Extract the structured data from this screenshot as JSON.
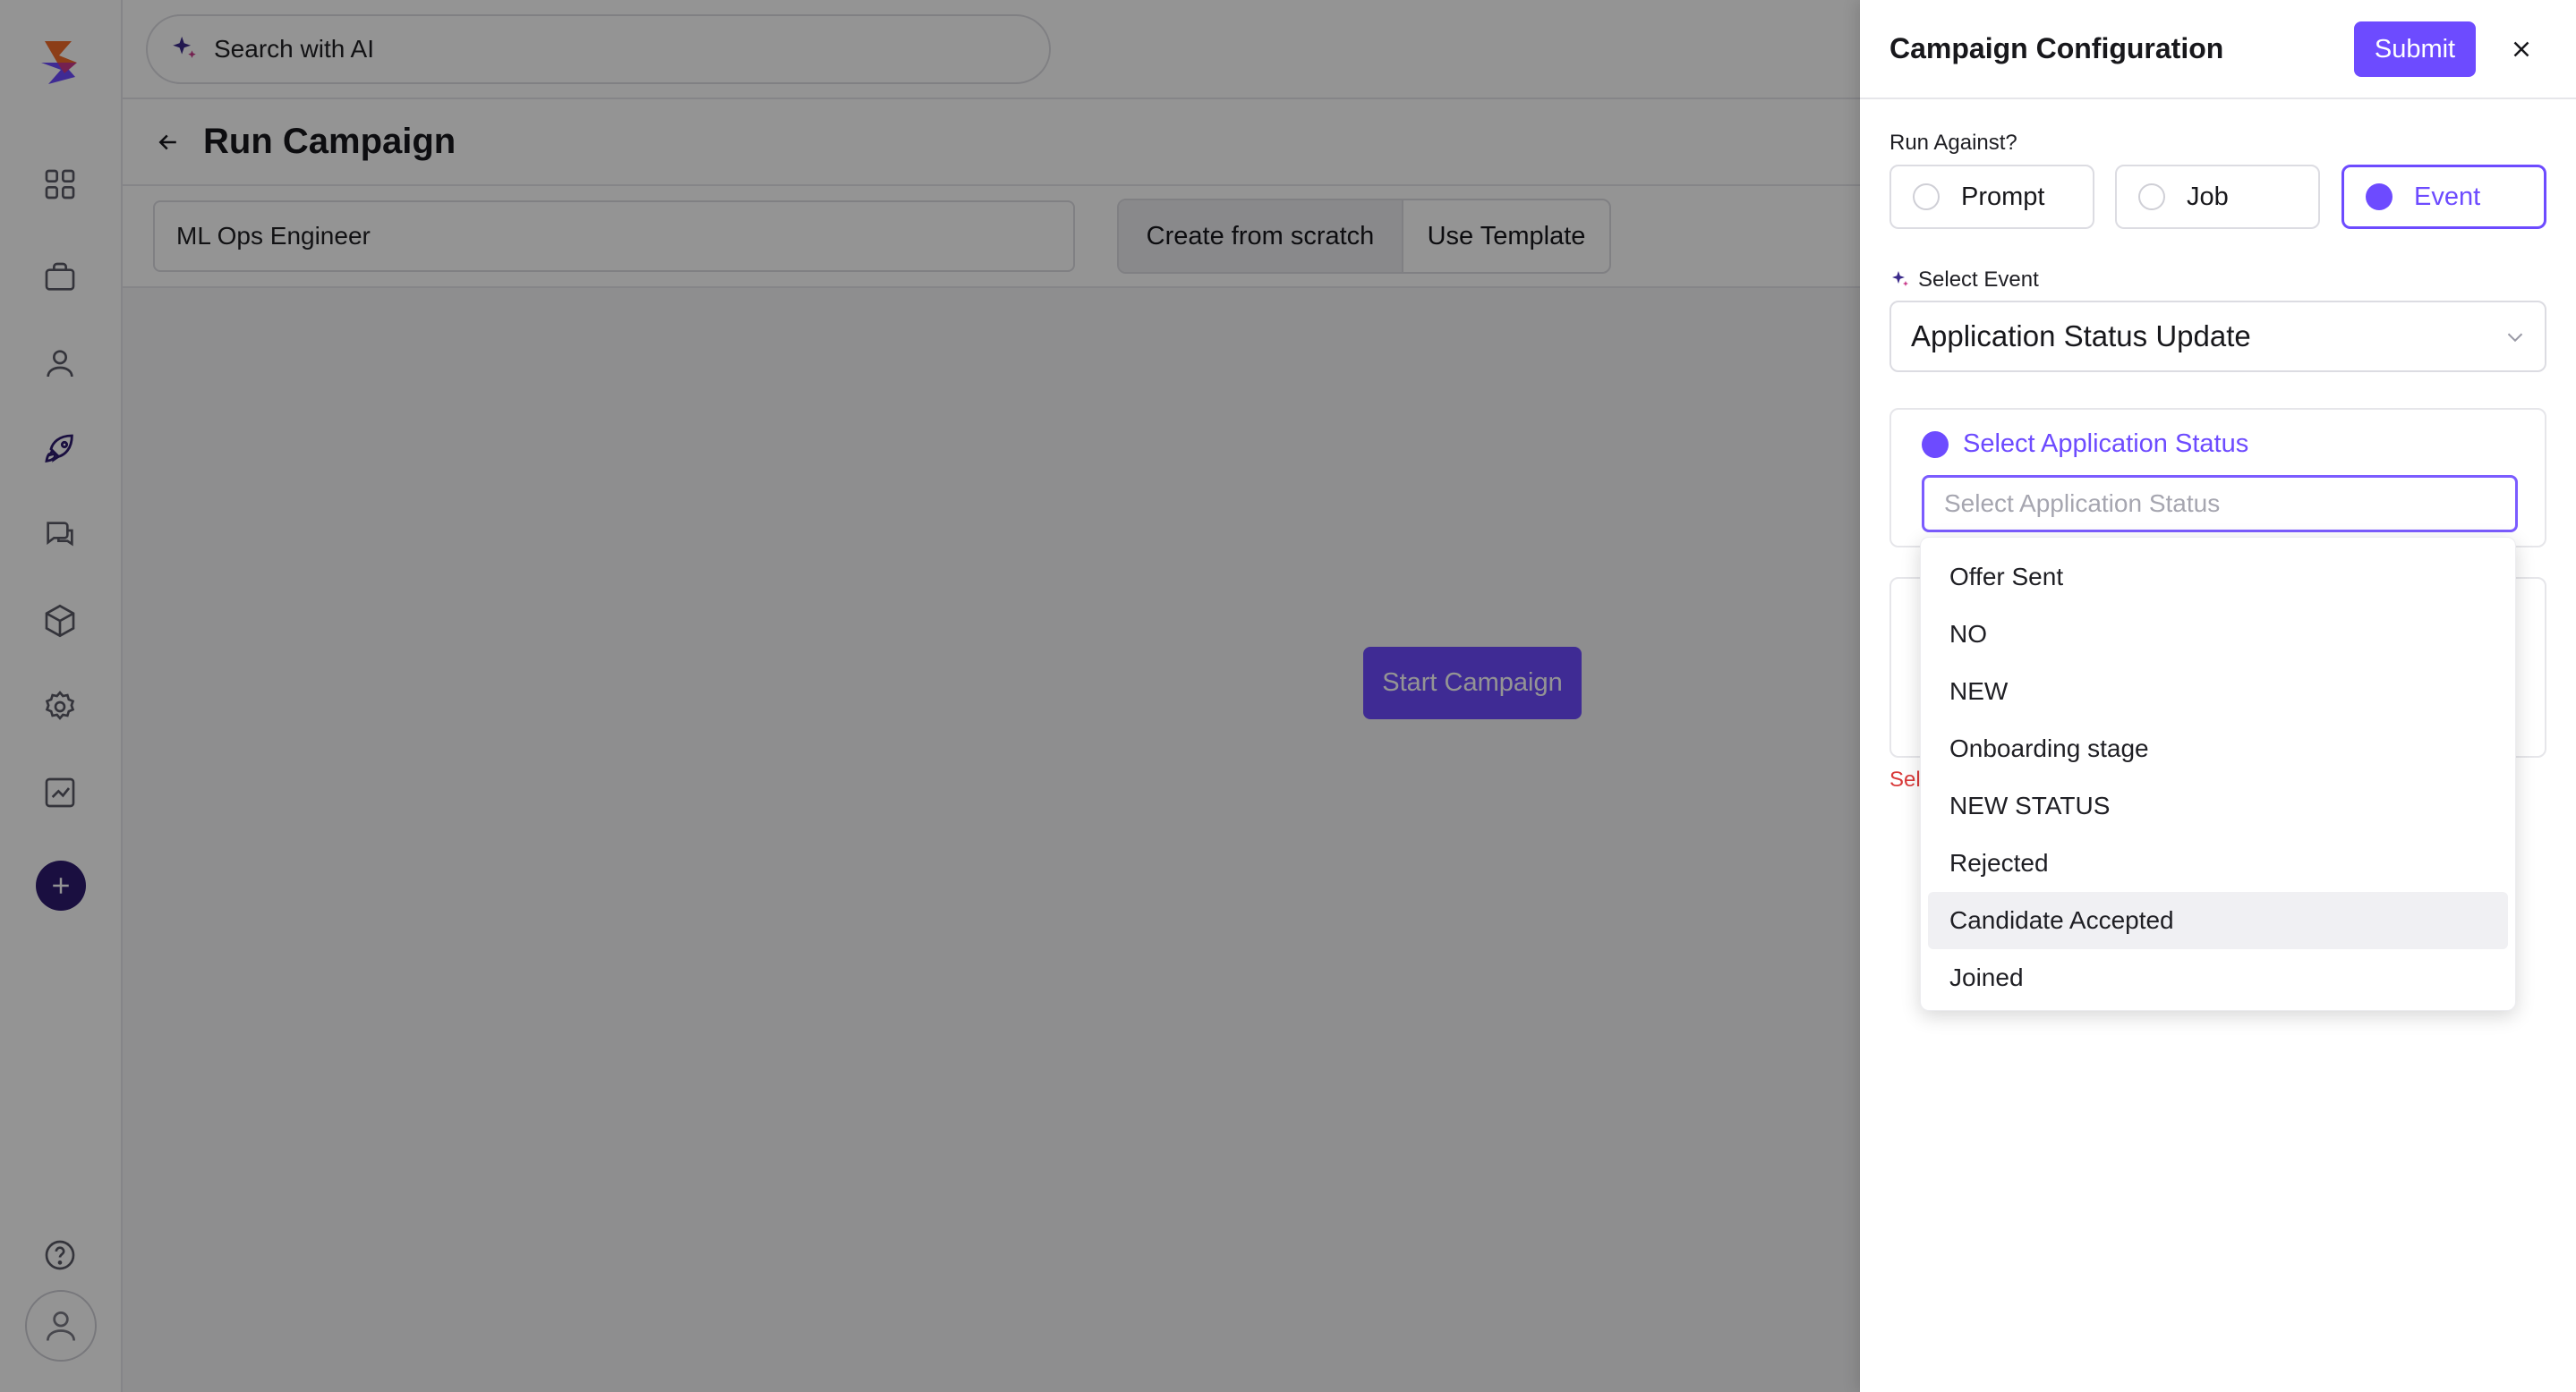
{
  "search": {
    "label": "Search with AI"
  },
  "page": {
    "title": "Run Campaign"
  },
  "campaign": {
    "name_value": "ML Ops Engineer",
    "mode_options": [
      "Create from scratch",
      "Use Template"
    ],
    "start_label": "Start Campaign"
  },
  "drawer": {
    "title": "Campaign Configuration",
    "submit_label": "Submit",
    "run_against_label": "Run Against?",
    "run_against_options": [
      "Prompt",
      "Job",
      "Event"
    ],
    "run_against_selected": "Event",
    "select_event_label": "Select Event",
    "event_value": "Application Status Update",
    "status_section_label": "Select Application Status",
    "status_placeholder": "Select Application Status",
    "status_options": [
      "Offer Sent",
      "NO",
      "NEW",
      "Onboarding stage",
      "NEW STATUS",
      "Rejected",
      "Candidate Accepted",
      "Joined"
    ],
    "hovered_option": "Candidate Accepted",
    "error_prefix": "Sel"
  },
  "colors": {
    "accent": "#6d4bff",
    "logo_orange": "#f26b2a",
    "logo_purple": "#6d4bff",
    "nav_dark": "#2d1b6e",
    "error": "#d93a3a"
  }
}
